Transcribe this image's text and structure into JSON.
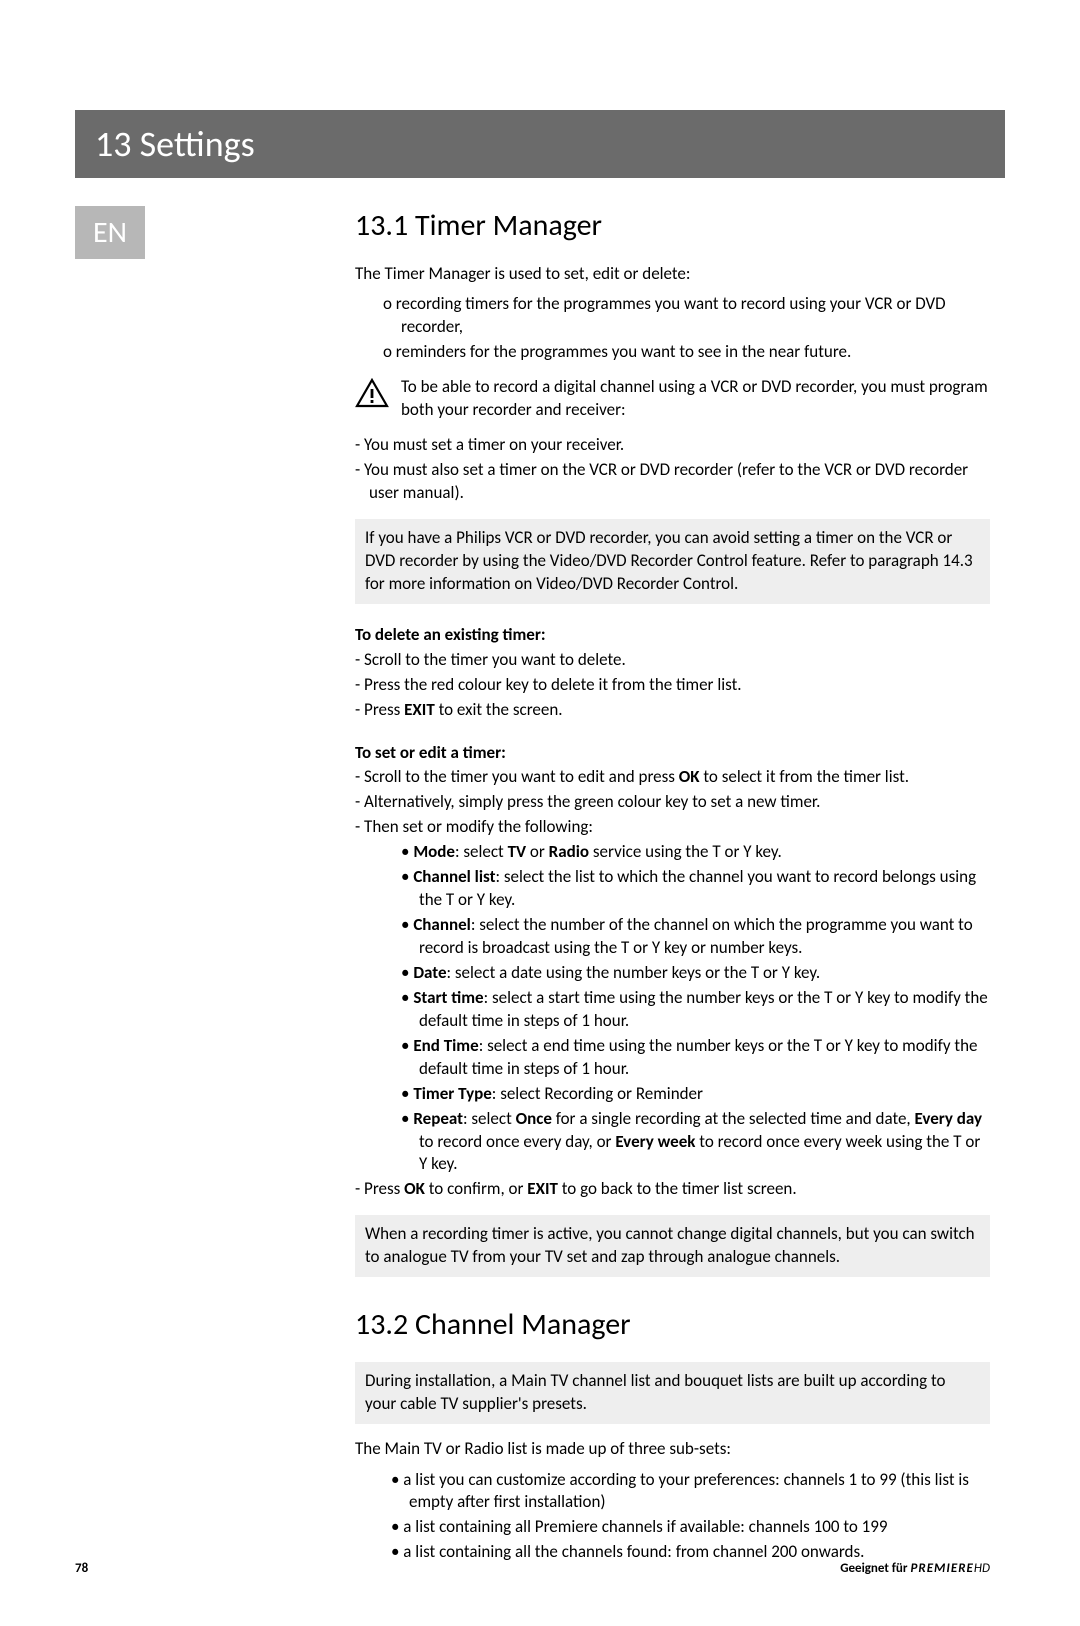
{
  "chapter": {
    "number": "13",
    "title": "Settings"
  },
  "lang_badge": "EN",
  "section_13_1": {
    "heading": "13.1 Timer Manager",
    "intro": "The Timer Manager is used to set, edit or delete:",
    "intro_items": [
      "o recording timers for the programmes you want to record using your VCR or DVD recorder,",
      "o reminders for the programmes you want to see in the near future."
    ],
    "warning_text": "To be able to record a digital channel using a VCR or DVD recorder, you must program both your recorder and receiver:",
    "warning_list": [
      "- You must set a timer on your receiver.",
      "- You must also set a timer on the VCR or DVD recorder (refer to the VCR or DVD recorder user manual)."
    ],
    "info_box_1": "If you have a Philips VCR or DVD recorder, you can avoid setting a timer on the VCR or DVD recorder by using the Video/DVD Recorder Control feature. Refer to paragraph 14.3 for more information on Video/DVD Recorder Control.",
    "delete_head": "To delete an existing timer:",
    "delete_steps": [
      {
        "pre": "- Scroll to the timer you want to delete."
      },
      {
        "pre": "- Press the red colour key to delete it from the timer list."
      },
      {
        "pre": "- Press ",
        "bold": "EXIT",
        "post": " to exit the screen."
      }
    ],
    "set_head": "To set or edit a timer:",
    "set_steps_top": [
      {
        "pre": "- Scroll to the timer you want to edit and press ",
        "bold": "OK",
        "post": " to select it from the timer list."
      },
      {
        "pre": "- Alternatively, simply press the green colour key to set a new timer."
      },
      {
        "pre": "- Then set or modify the following:"
      }
    ],
    "set_sub_bullets": [
      {
        "label": "Mode",
        "rest": ": select ",
        "b2": "TV",
        "mid": " or ",
        "b3": "Radio",
        "post": " service using the T or Y key."
      },
      {
        "label": "Channel list",
        "rest": ": select the list to which the channel you want to record belongs using the T or Y key."
      },
      {
        "label": "Channel",
        "rest": ": select the number of the channel on which the programme you want to record is broadcast using the T or Y key or number keys."
      },
      {
        "label": "Date",
        "rest": ": select a date using the number keys or the T or Y key."
      },
      {
        "label": "Start time",
        "rest": ": select a start time using the number keys or the T or Y key to modify the default time in steps of 1 hour."
      },
      {
        "label": "End Time",
        "rest": ": select a end time using the number keys or the T or Y key to modify the default time in steps of 1 hour."
      },
      {
        "label": "Timer Type",
        "rest": ": select Recording or Reminder"
      },
      {
        "label": "Repeat",
        "rest": ": select ",
        "b2": "Once",
        "mid": " for a single recording at the selected time and date, ",
        "b3": "Every day",
        "mid2": " to record once every day, or ",
        "b4": "Every week",
        "post": " to record once every week using the T or Y key."
      }
    ],
    "set_steps_bottom": [
      {
        "pre": "- Press ",
        "bold": "OK",
        "mid": " to confirm, or ",
        "bold2": "EXIT",
        "post": " to go back to the timer list screen."
      }
    ],
    "info_box_2": "When a recording timer is active, you cannot change digital channels, but you can switch to analogue TV from your TV set and zap through analogue channels."
  },
  "section_13_2": {
    "heading": "13.2 Channel Manager",
    "info_box": "During installation, a Main TV channel list and bouquet lists are built up according to your cable TV supplier's presets.",
    "para": "The Main TV or Radio list is made up of three sub-sets:",
    "bullets": [
      "• a list you can customize according to your preferences: channels 1 to 99 (this list is empty after first installation)",
      "• a list containing all Premiere channels if available: channels 100 to 199",
      "• a list containing all the channels found: from channel 200 onwards."
    ]
  },
  "footer": {
    "page_no": "78",
    "right_prefix": "Geeignet für ",
    "brand_main": "PREMIERE",
    "brand_suffix": "HD"
  }
}
